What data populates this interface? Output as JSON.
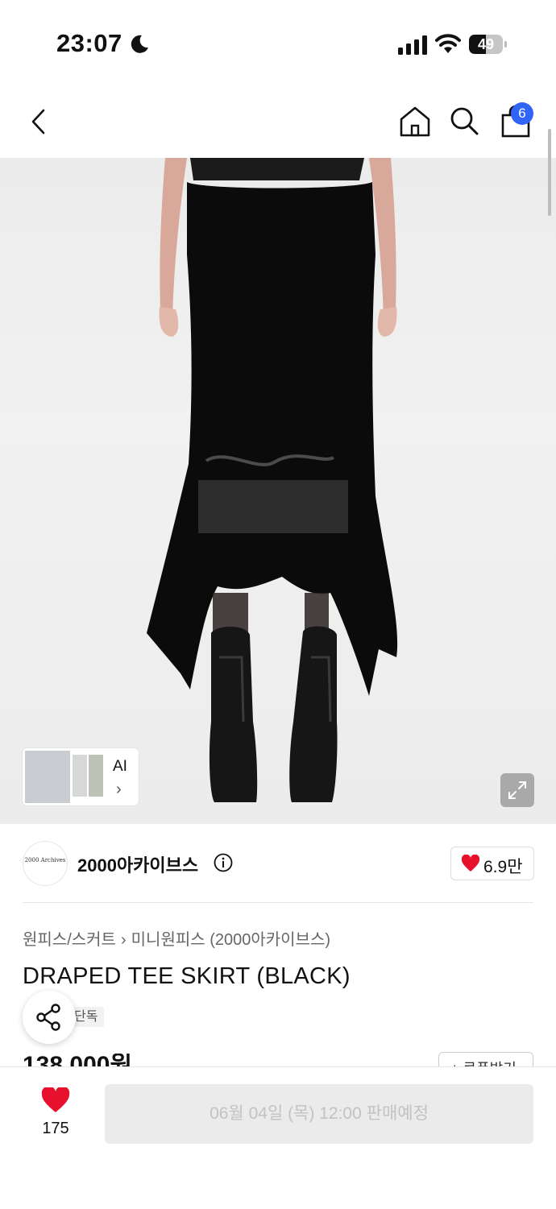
{
  "status_bar": {
    "time": "23:07",
    "battery": "49",
    "battery_level": 0.49
  },
  "nav": {
    "cart_count": "6"
  },
  "gallery": {
    "ai_label": "AI",
    "chevron": "›"
  },
  "brand": {
    "logo_text": "2000 Archives",
    "name": "2000아카이브스",
    "likes": "6.9만"
  },
  "breadcrumb": {
    "category": "원피스/스커트",
    "separator": "›",
    "subcategory": "미니원피스 (2000아카이브스)"
  },
  "product": {
    "title": "DRAPED TEE SKIRT (BLACK)",
    "tag": "단독",
    "price": "138,000원",
    "coupon_label": "+ 쿠폰받기"
  },
  "bottom_bar": {
    "like_count": "175",
    "buy_label": "06월 04일 (목) 12:00 판매예정"
  },
  "colors": {
    "badge": "#2f64f5",
    "heart": "#e8112d",
    "buy_button_bg": "#ebebeb",
    "buy_button_text": "#c2c2c2"
  },
  "icons": [
    "moon-icon",
    "signal-icon",
    "wifi-icon",
    "battery-icon",
    "back-icon",
    "home-icon",
    "search-icon",
    "bag-icon",
    "expand-icon",
    "info-icon",
    "heart-icon",
    "share-icon",
    "chevron-right-icon"
  ]
}
